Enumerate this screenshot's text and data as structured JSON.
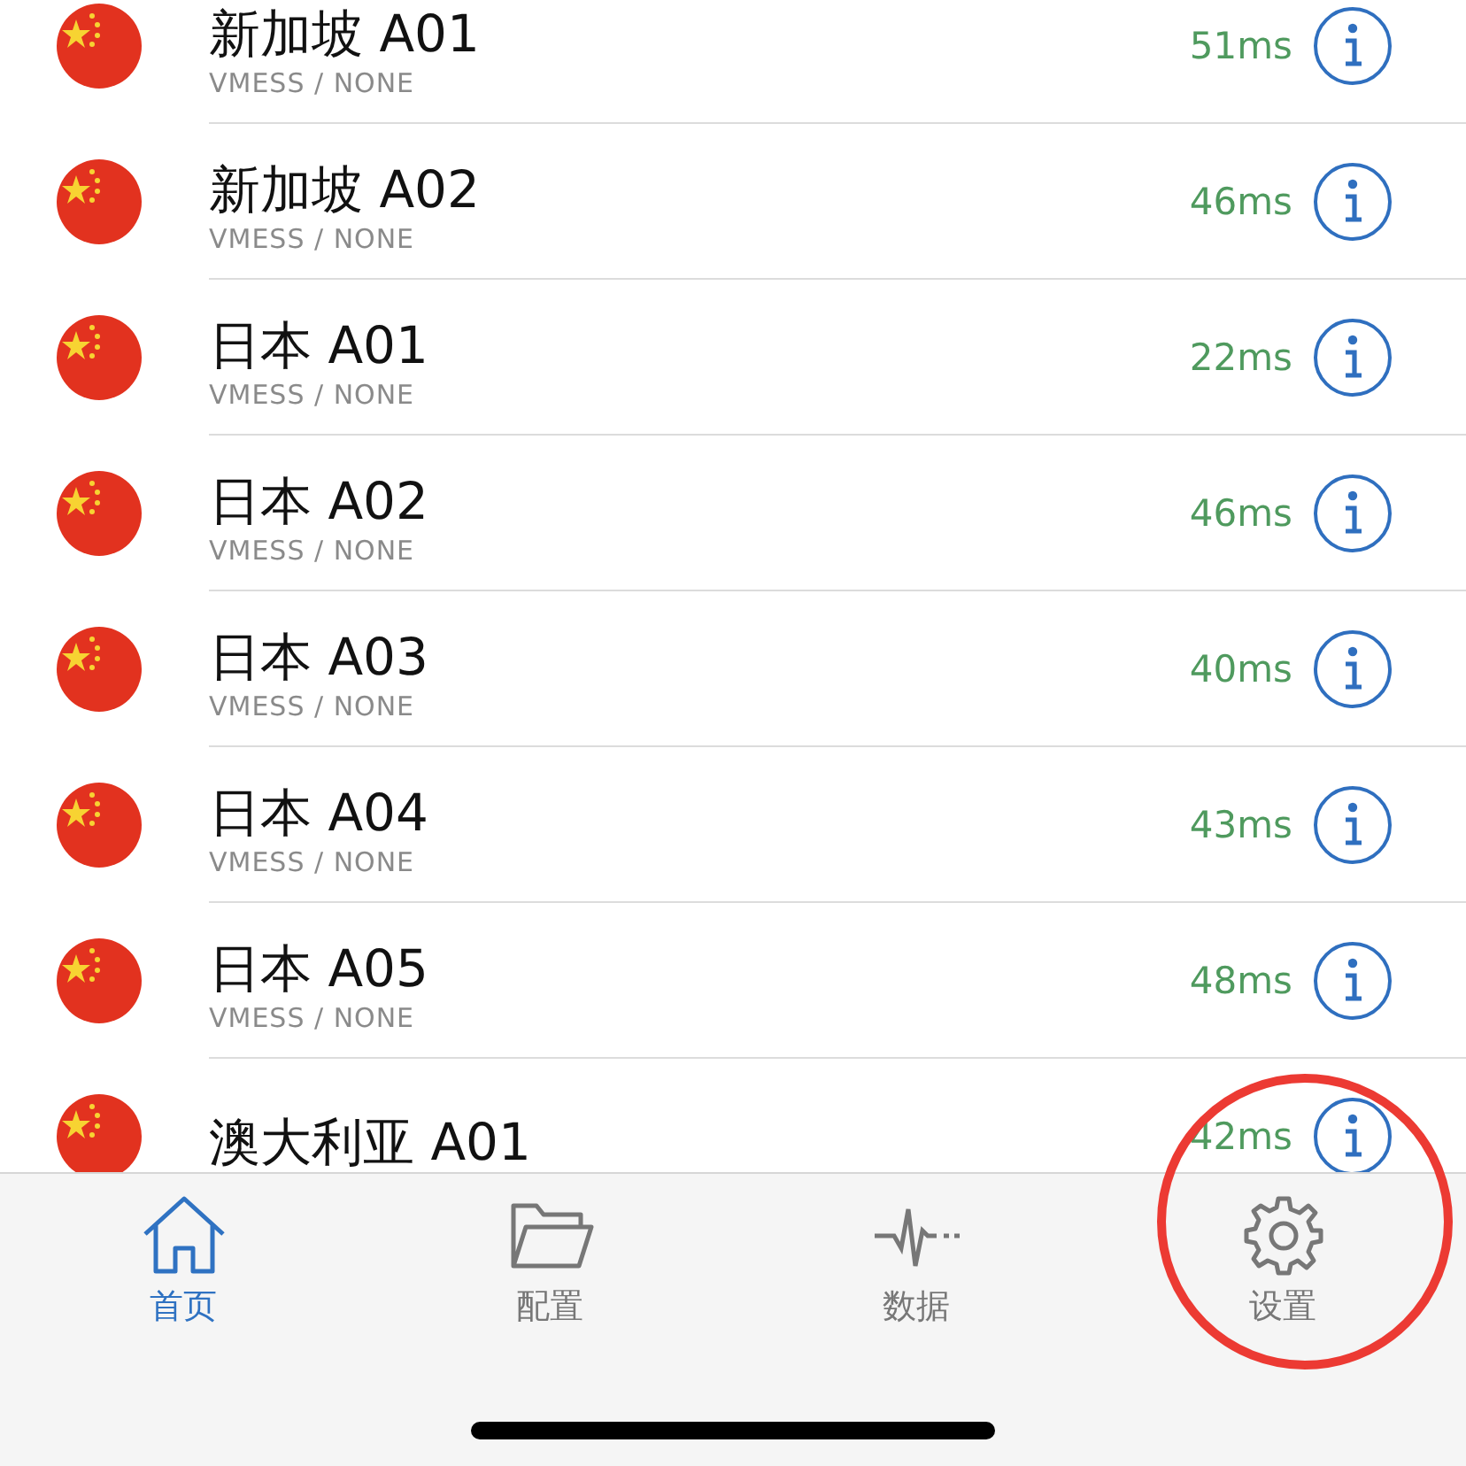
{
  "servers": [
    {
      "name": "新加坡 A01",
      "subtitle": "VMESS / NONE",
      "latency": "51ms"
    },
    {
      "name": "新加坡 A02",
      "subtitle": "VMESS / NONE",
      "latency": "46ms"
    },
    {
      "name": "日本 A01",
      "subtitle": "VMESS / NONE",
      "latency": "22ms"
    },
    {
      "name": "日本 A02",
      "subtitle": "VMESS / NONE",
      "latency": "46ms"
    },
    {
      "name": "日本 A03",
      "subtitle": "VMESS / NONE",
      "latency": "40ms"
    },
    {
      "name": "日本 A04",
      "subtitle": "VMESS / NONE",
      "latency": "43ms"
    },
    {
      "name": "日本 A05",
      "subtitle": "VMESS / NONE",
      "latency": "48ms"
    },
    {
      "name": "澳大利亚 A01",
      "latency": "42ms"
    }
  ],
  "tab_bar": [
    {
      "kind": "home",
      "label": "首页",
      "selected": true
    },
    {
      "kind": "folder",
      "label": "配置",
      "selected": false
    },
    {
      "kind": "pulse",
      "label": "数据",
      "selected": false
    },
    {
      "kind": "gear",
      "label": "设置",
      "selected": false
    }
  ],
  "annotation": {
    "kind": "circle"
  }
}
